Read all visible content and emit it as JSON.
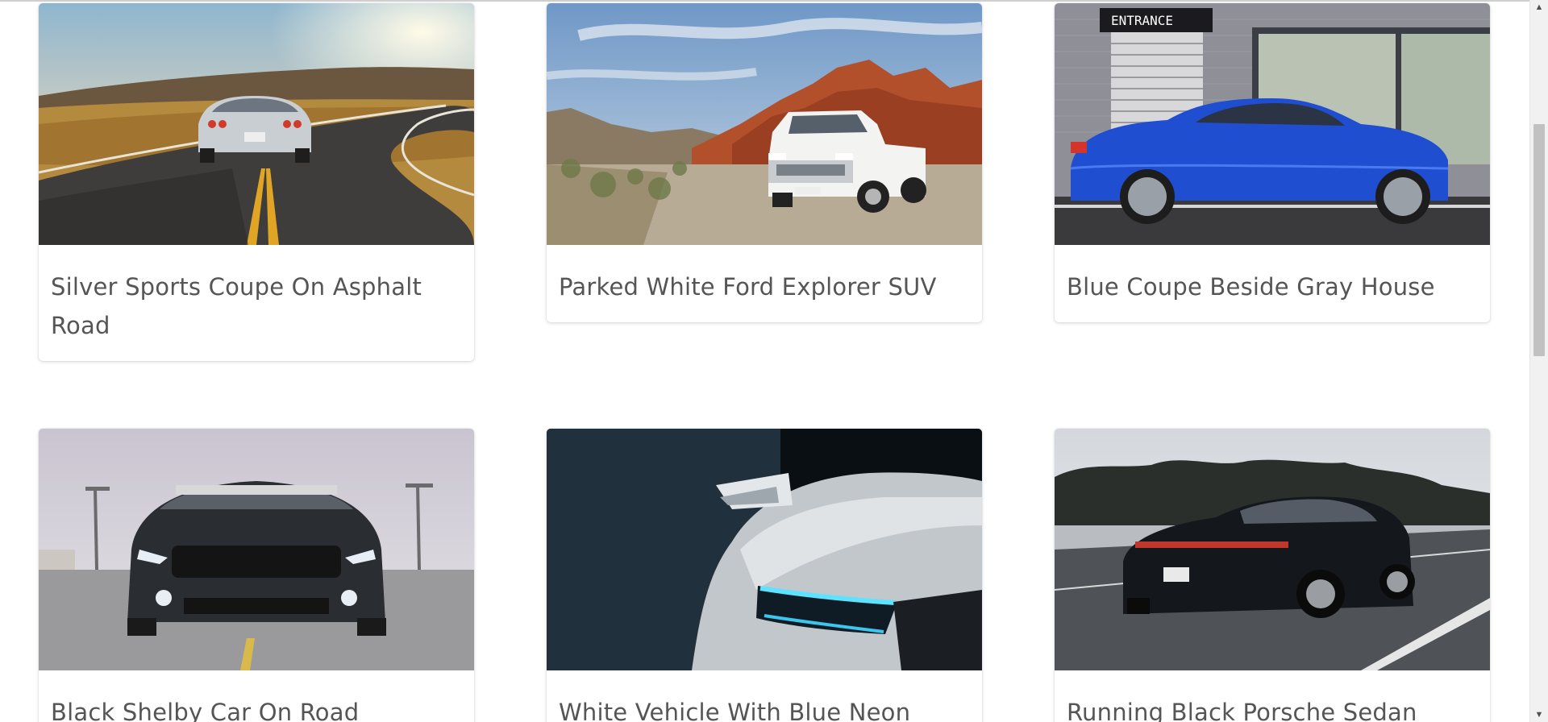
{
  "gallery": {
    "cards": [
      {
        "caption": "Silver Sports Coupe On Asphalt Road",
        "image": "silver-sports-coupe-photo"
      },
      {
        "caption": "Parked White Ford Explorer SUV",
        "image": "white-ford-explorer-photo"
      },
      {
        "caption": "Blue Coupe Beside Gray House",
        "image": "blue-coupe-photo"
      },
      {
        "caption": "Black Shelby Car On Road",
        "image": "black-shelby-photo"
      },
      {
        "caption": "White Vehicle With Blue Neon",
        "image": "white-vehicle-neon-photo"
      },
      {
        "caption": "Running Black Porsche Sedan",
        "image": "black-porsche-photo"
      }
    ],
    "entrance_sign": "ENTRANCE"
  },
  "scrollbar": {
    "up_icon": "triangle-up-icon",
    "down_icon": "triangle-down-icon"
  }
}
